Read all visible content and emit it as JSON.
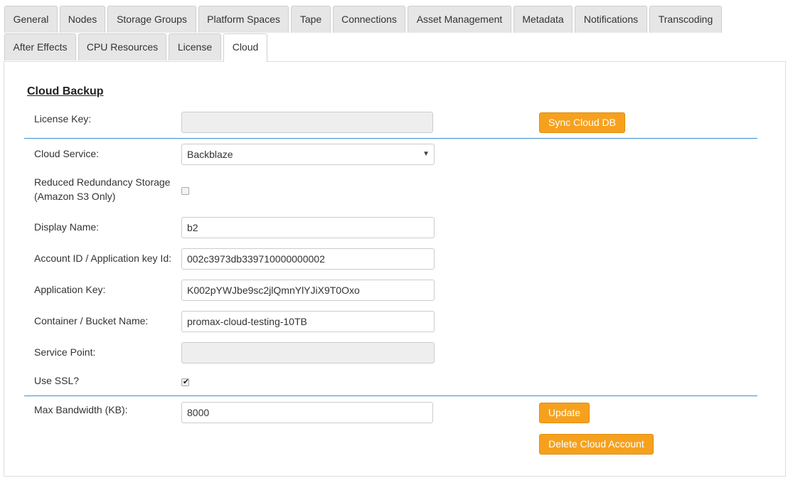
{
  "tabs": {
    "row1": [
      "General",
      "Nodes",
      "Storage Groups",
      "Platform Spaces",
      "Tape",
      "Connections",
      "Asset Management",
      "Metadata",
      "Notifications",
      "Transcoding"
    ],
    "row2": [
      "After Effects",
      "CPU Resources",
      "License",
      "Cloud"
    ],
    "active": "Cloud"
  },
  "section": {
    "title": "Cloud Backup"
  },
  "form": {
    "license_key": {
      "label": "License Key:",
      "value": ""
    },
    "sync_button": "Sync Cloud DB",
    "cloud_service": {
      "label": "Cloud Service:",
      "value": "Backblaze"
    },
    "reduced_redundancy": {
      "label_line1": "Reduced Redundancy Storage",
      "label_line2": "(Amazon S3 Only)",
      "checked": false
    },
    "display_name": {
      "label": "Display Name:",
      "value": "b2"
    },
    "account_id": {
      "label": "Account ID / Application key Id:",
      "value": "002c3973db339710000000002"
    },
    "application_key": {
      "label": "Application Key:",
      "value": "K002pYWJbe9sc2jlQmnYlYJiX9T0Oxo"
    },
    "bucket_name": {
      "label": "Container / Bucket Name:",
      "value": "promax-cloud-testing-10TB"
    },
    "service_point": {
      "label": "Service Point:",
      "value": ""
    },
    "use_ssl": {
      "label": "Use SSL?",
      "checked": true
    },
    "max_bandwidth": {
      "label": "Max Bandwidth (KB):",
      "value": "8000"
    },
    "update_button": "Update",
    "delete_button": "Delete Cloud Account"
  },
  "colors": {
    "accent_button": "#f6a11e",
    "divider": "#3d8fd1"
  }
}
